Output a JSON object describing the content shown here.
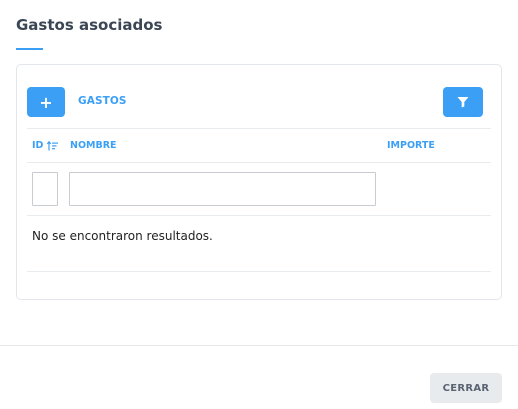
{
  "dialog": {
    "title": "Gastos asociados",
    "close_label": "CERRAR"
  },
  "toolbar": {
    "add_label": "+",
    "section_label": "GASTOS"
  },
  "table": {
    "columns": [
      {
        "key": "id",
        "label": "ID"
      },
      {
        "key": "nombre",
        "label": "NOMBRE"
      },
      {
        "key": "importe",
        "label": "IMPORTE"
      }
    ],
    "filters": {
      "id": "",
      "nombre": ""
    },
    "empty_message": "No se encontraron resultados.",
    "rows": []
  },
  "colors": {
    "accent": "#3b9ff5",
    "title": "#3b4654"
  }
}
